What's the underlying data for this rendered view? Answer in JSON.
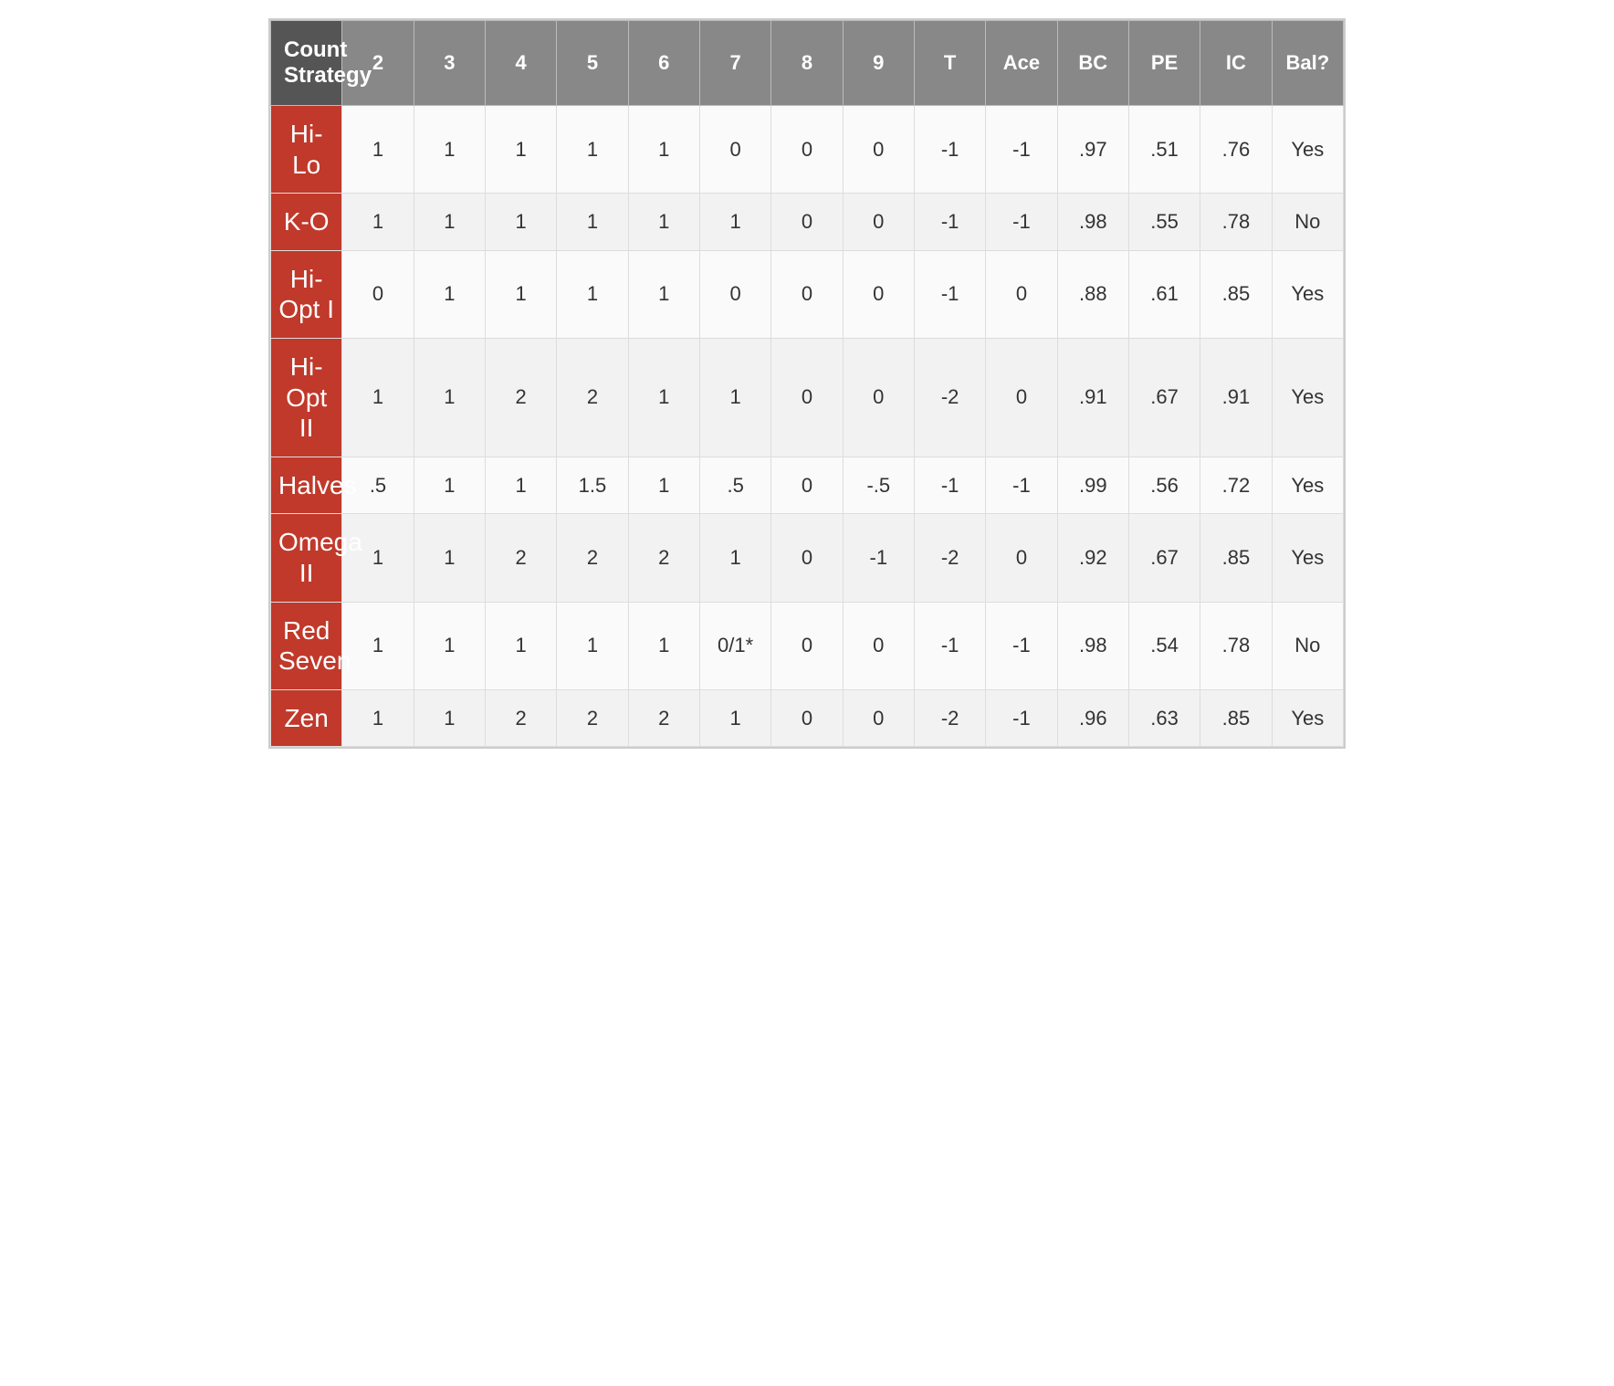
{
  "table": {
    "headers": [
      "Count Strategy",
      "2",
      "3",
      "4",
      "5",
      "6",
      "7",
      "8",
      "9",
      "T",
      "Ace",
      "BC",
      "PE",
      "IC",
      "Bal?"
    ],
    "rows": [
      {
        "strategy": "Hi-Lo",
        "values": [
          "1",
          "1",
          "1",
          "1",
          "1",
          "0",
          "0",
          "0",
          "-1",
          "-1",
          ".97",
          ".51",
          ".76",
          "Yes"
        ]
      },
      {
        "strategy": "K-O",
        "values": [
          "1",
          "1",
          "1",
          "1",
          "1",
          "1",
          "0",
          "0",
          "-1",
          "-1",
          ".98",
          ".55",
          ".78",
          "No"
        ]
      },
      {
        "strategy": "Hi-Opt I",
        "values": [
          "0",
          "1",
          "1",
          "1",
          "1",
          "0",
          "0",
          "0",
          "-1",
          "0",
          ".88",
          ".61",
          ".85",
          "Yes"
        ]
      },
      {
        "strategy": "Hi-Opt II",
        "values": [
          "1",
          "1",
          "2",
          "2",
          "1",
          "1",
          "0",
          "0",
          "-2",
          "0",
          ".91",
          ".67",
          ".91",
          "Yes"
        ]
      },
      {
        "strategy": "Halves",
        "values": [
          ".5",
          "1",
          "1",
          "1.5",
          "1",
          ".5",
          "0",
          "-.5",
          "-1",
          "-1",
          ".99",
          ".56",
          ".72",
          "Yes"
        ]
      },
      {
        "strategy": "Omega II",
        "values": [
          "1",
          "1",
          "2",
          "2",
          "2",
          "1",
          "0",
          "-1",
          "-2",
          "0",
          ".92",
          ".67",
          ".85",
          "Yes"
        ]
      },
      {
        "strategy": "Red Seven",
        "values": [
          "1",
          "1",
          "1",
          "1",
          "1",
          "0/1*",
          "0",
          "0",
          "-1",
          "-1",
          ".98",
          ".54",
          ".78",
          "No"
        ]
      },
      {
        "strategy": "Zen",
        "values": [
          "1",
          "1",
          "2",
          "2",
          "2",
          "1",
          "0",
          "0",
          "-2",
          "-1",
          ".96",
          ".63",
          ".85",
          "Yes"
        ]
      }
    ]
  }
}
